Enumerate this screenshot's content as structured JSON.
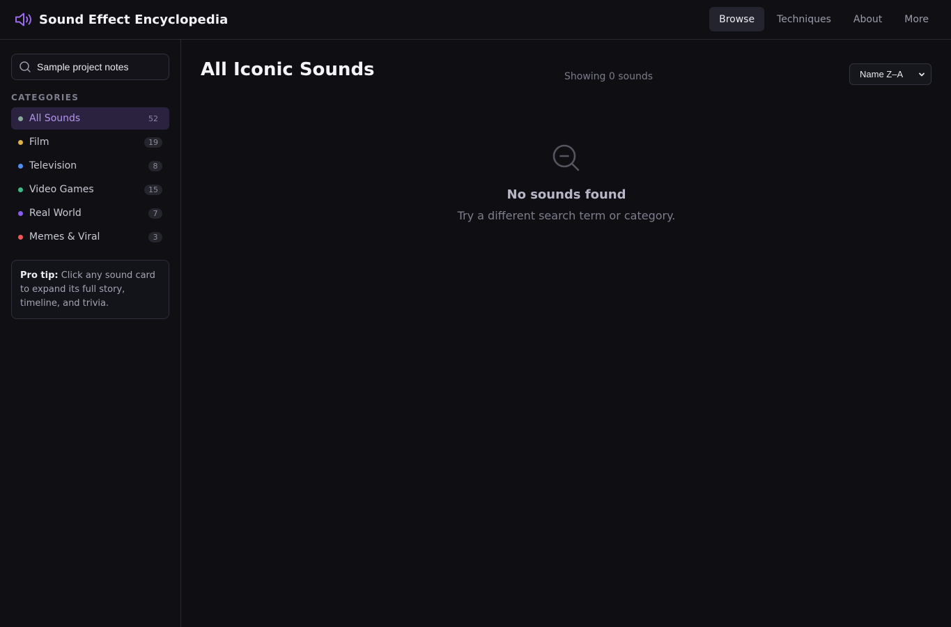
{
  "header": {
    "title": "Sound Effect Encyclopedia",
    "logo_icon": "speaker-icon",
    "nav": [
      {
        "label": "Browse",
        "active": true
      },
      {
        "label": "Techniques",
        "active": false
      },
      {
        "label": "About",
        "active": false
      },
      {
        "label": "More",
        "active": false
      }
    ]
  },
  "sidebar": {
    "search": {
      "value": "Sample project notes",
      "placeholder": "Search sounds..."
    },
    "categories_title": "CATEGORIES",
    "categories": [
      {
        "label": "All Sounds",
        "count": "52",
        "color": "#8aa79a",
        "active": true
      },
      {
        "label": "Film",
        "count": "19",
        "color": "#e2b04a",
        "active": false
      },
      {
        "label": "Television",
        "count": "8",
        "color": "#4f8ff0",
        "active": false
      },
      {
        "label": "Video Games",
        "count": "15",
        "color": "#3dbb8a",
        "active": false
      },
      {
        "label": "Real World",
        "count": "7",
        "color": "#8a5cf0",
        "active": false
      },
      {
        "label": "Memes & Viral",
        "count": "3",
        "color": "#ee5a5a",
        "active": false
      }
    ],
    "tip": {
      "strong": "Pro tip:",
      "text": " Click any sound card to expand its full story, timeline, and trivia."
    }
  },
  "main": {
    "title": "All Iconic Sounds",
    "result_count": "Showing 0 sounds",
    "sort": {
      "selected": "Name Z–A"
    },
    "empty": {
      "icon": "search-minus-icon",
      "title": "No sounds found",
      "subtitle": "Try a different search term or category."
    }
  },
  "colors": {
    "accent": "#9b6cf0",
    "background": "#0e0e13",
    "border": "#2a2a33"
  }
}
